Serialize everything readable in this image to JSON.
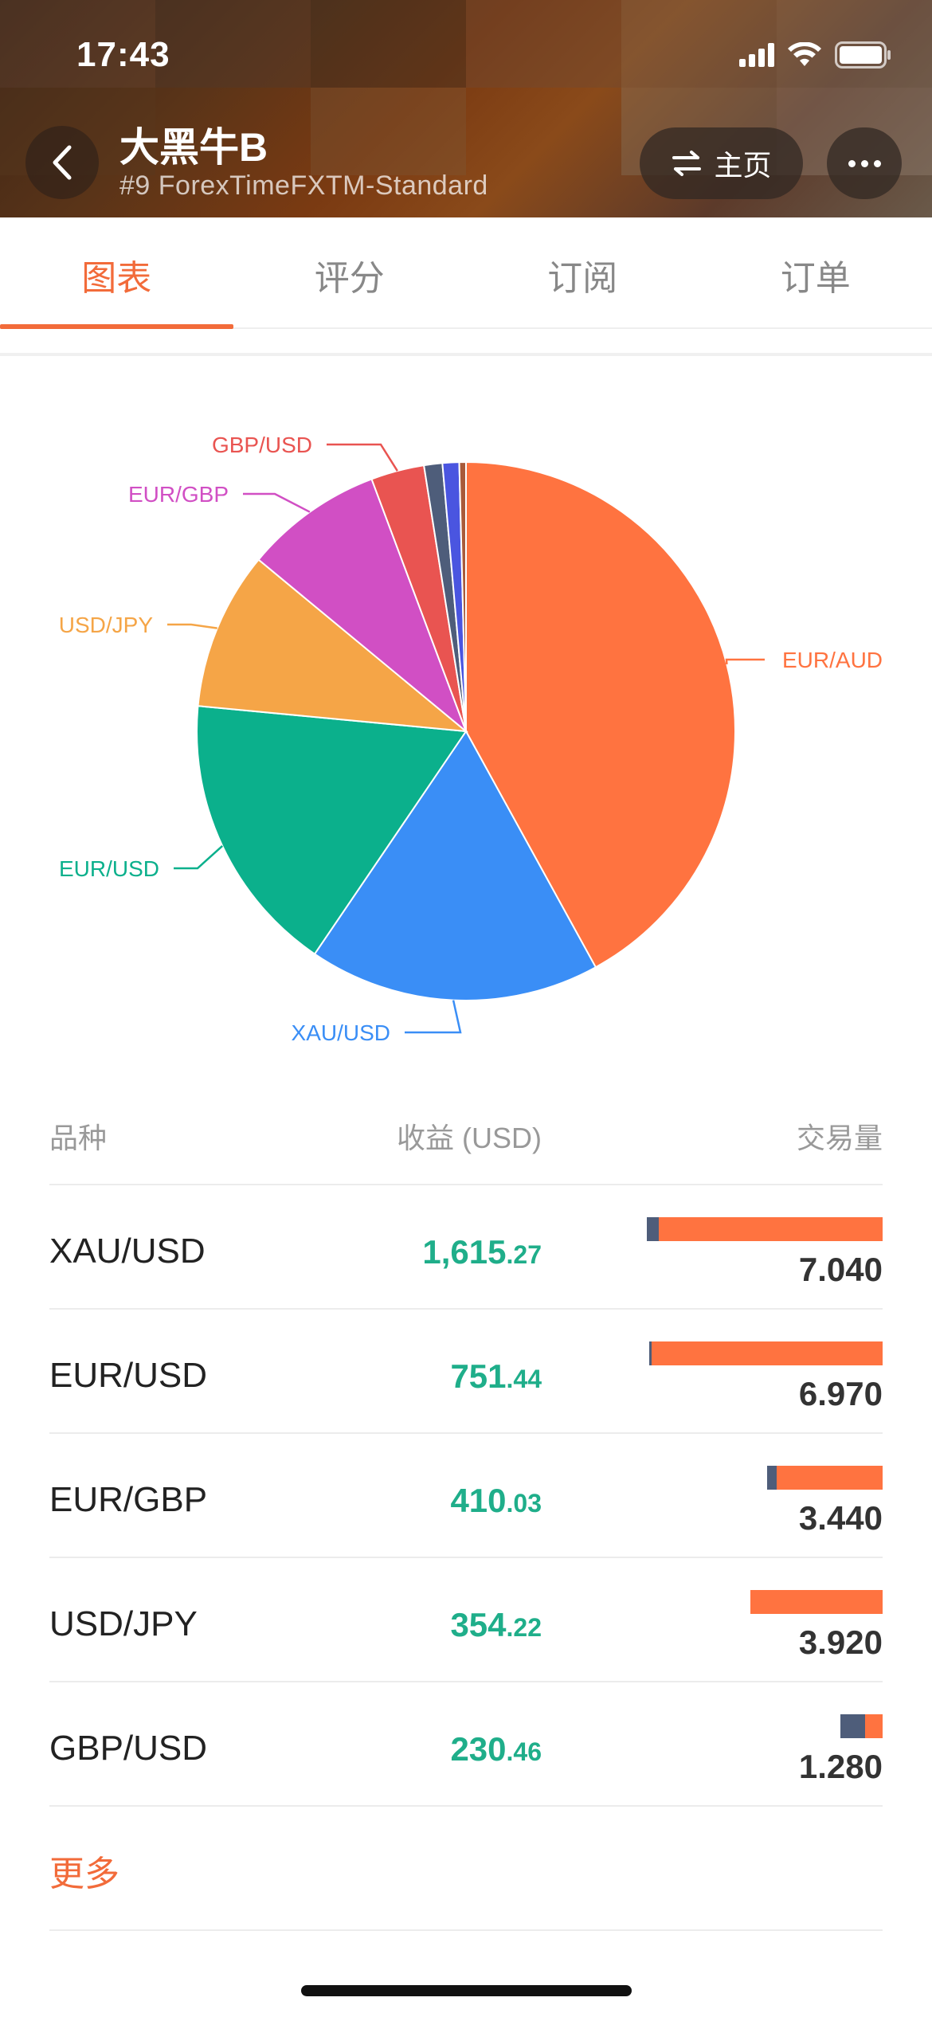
{
  "status_bar": {
    "time": "17:43"
  },
  "header": {
    "title": "大黑牛B",
    "subtitle": "#9 ForexTimeFXTM-Standard",
    "home_label": "主页"
  },
  "tabs": [
    {
      "label": "图表",
      "active": true
    },
    {
      "label": "评分",
      "active": false
    },
    {
      "label": "订阅",
      "active": false
    },
    {
      "label": "订单",
      "active": false
    }
  ],
  "chart_data": {
    "type": "pie",
    "slices": [
      {
        "label": "EUR/AUD",
        "value": 42.0,
        "color": "#ff7340"
      },
      {
        "label": "XAU/USD",
        "value": 17.5,
        "color": "#3a8ef6"
      },
      {
        "label": "EUR/USD",
        "value": 17.0,
        "color": "#0bb08c"
      },
      {
        "label": "USD/JPY",
        "value": 9.5,
        "color": "#f5a547"
      },
      {
        "label": "EUR/GBP",
        "value": 8.3,
        "color": "#d14fc4"
      },
      {
        "label": "GBP/USD",
        "value": 3.2,
        "color": "#e95451"
      },
      {
        "label": "",
        "value": 1.1,
        "color": "#4e5d7a"
      },
      {
        "label": "",
        "value": 1.0,
        "color": "#4a55e0"
      },
      {
        "label": "",
        "value": 0.4,
        "color": "#a85a3a"
      }
    ]
  },
  "table": {
    "headers": {
      "symbol": "品种",
      "profit": "收益 (USD)",
      "volume": "交易量"
    },
    "rows": [
      {
        "symbol": "XAU/USD",
        "profit_int": "1,615",
        "profit_dec": ".27",
        "volume": "7.040",
        "bar_fraction": 1.0,
        "dark_fraction": 0.05
      },
      {
        "symbol": "EUR/USD",
        "profit_int": "751",
        "profit_dec": ".44",
        "volume": "6.970",
        "bar_fraction": 0.99,
        "dark_fraction": 0.01
      },
      {
        "symbol": "EUR/GBP",
        "profit_int": "410",
        "profit_dec": ".03",
        "volume": "3.440",
        "bar_fraction": 0.49,
        "dark_fraction": 0.08
      },
      {
        "symbol": "USD/JPY",
        "profit_int": "354",
        "profit_dec": ".22",
        "volume": "3.920",
        "bar_fraction": 0.56,
        "dark_fraction": 0.0
      },
      {
        "symbol": "GBP/USD",
        "profit_int": "230",
        "profit_dec": ".46",
        "volume": "1.280",
        "bar_fraction": 0.18,
        "dark_fraction": 0.58
      }
    ],
    "more_label": "更多"
  }
}
